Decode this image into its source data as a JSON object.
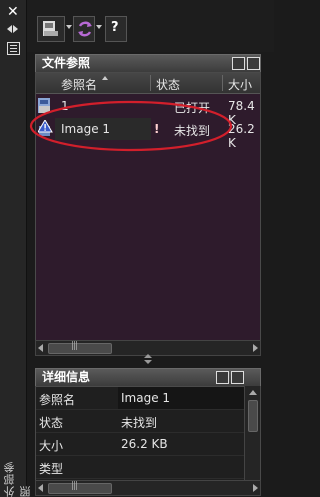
{
  "palette_title": "外部参照",
  "toolbar": {
    "attach_icon": "attach-dwg-icon",
    "refresh_icon": "refresh-icon",
    "help_icon": "help-icon",
    "help_label": "?"
  },
  "file_refs": {
    "title": "文件参照",
    "list_view_icon": "list-view-icon",
    "tree_view_icon": "tree-view-icon",
    "columns": [
      "参照名",
      "状态",
      "大小"
    ],
    "rows": [
      {
        "icon": "drawing-icon",
        "name": "1",
        "flag": "",
        "status": "已打开",
        "size": "78.4 K"
      },
      {
        "icon": "image-warning-icon",
        "name": "Image 1",
        "flag": "!",
        "status": "未找到",
        "size": "26.2 K"
      }
    ],
    "highlight_color": "#d21f2b"
  },
  "details": {
    "title": "详细信息",
    "properties_icon": "properties-icon",
    "preview_icon": "preview-icon",
    "rows": [
      {
        "key": "参照名",
        "value": "Image 1"
      },
      {
        "key": "状态",
        "value": "未找到"
      },
      {
        "key": "大小",
        "value": "26.2 KB"
      },
      {
        "key": "类型",
        "value": ""
      }
    ]
  },
  "colors": {
    "list_background": "#2e1b2c",
    "panel_background": "#1b1b1b",
    "title_bar": "#4a4a4a"
  }
}
